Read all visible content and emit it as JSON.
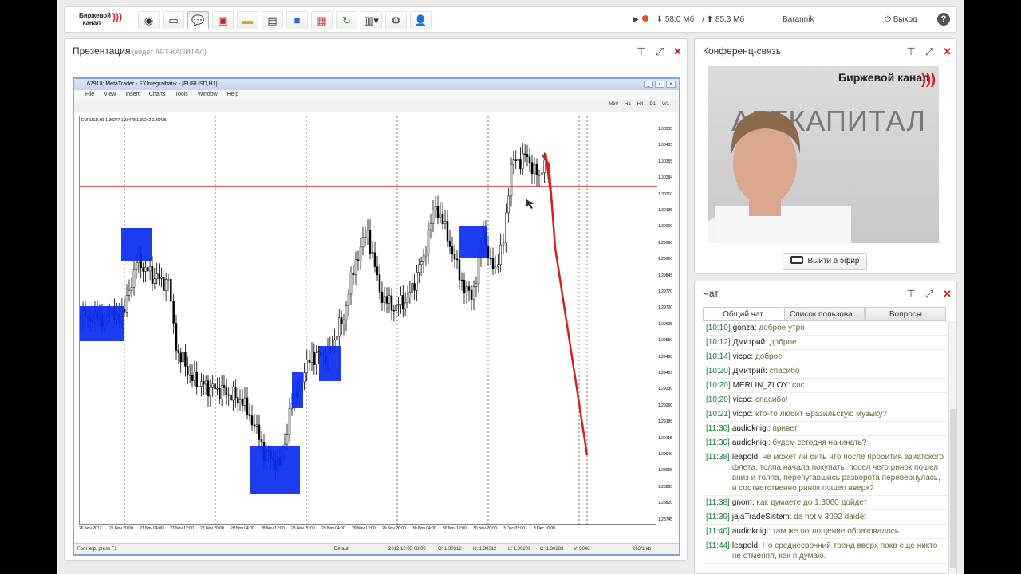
{
  "toolbar": {
    "logo_text": "Биржевой канал",
    "icons": [
      "webcam-icon",
      "screen-icon",
      "chat-bubble-icon",
      "gift-icon",
      "folder-icon",
      "document-icon",
      "boxes-icon",
      "notepad-icon",
      "share-folder-icon",
      "layout-icon",
      "gear-icon",
      "add-user-icon"
    ],
    "download": "58.0 Мб",
    "upload": "85.3 Мб",
    "username": "Barannik",
    "logout_label": "Выход",
    "help_label": "?"
  },
  "presentation": {
    "title": "Презентация",
    "subtitle": "(ведет АРТ-КАПИТАЛ)"
  },
  "metatrader": {
    "window_title": "67918: MetaTrader - FXIntegralbank - [EURUSD,H1]",
    "menu": [
      "File",
      "View",
      "Insert",
      "Charts",
      "Tools",
      "Window",
      "Help"
    ],
    "timeframes": [
      "M30",
      "H1",
      "H4",
      "D1",
      "W1"
    ],
    "symbol_line": "EURUSD,H1  1.30277 1.30478 1.30242 1.30435",
    "price_labels": [
      "1.30505",
      "1.30435",
      "1.30355",
      "1.30284",
      "1.30210",
      "1.30135",
      "1.30060",
      "1.29990",
      "1.29920",
      "1.29845",
      "1.29770",
      "1.29700",
      "1.29625",
      "1.29550",
      "1.29480",
      "1.29405",
      "1.29330",
      "1.29260",
      "1.29185",
      "1.29115",
      "1.29040",
      "1.28965",
      "1.28895",
      "1.28820",
      "1.28745"
    ],
    "time_labels": [
      "26 Nov 2012",
      "26 Nov 20:00",
      "27 Nov 04:00",
      "27 Nov 12:00",
      "27 Nov 20:00",
      "28 Nov 04:00",
      "28 Nov 12:00",
      "28 Nov 20:00",
      "29 Nov 04:00",
      "29 Nov 12:00",
      "29 Nov 20:00",
      "30 Nov 04:00",
      "30 Nov 12:00",
      "30 Nov 20:00",
      "3 Dec 02:00",
      "3 Dec 10:00"
    ],
    "status": {
      "help": "For Help, press F1",
      "profile": "Default",
      "time": "2012.12.03 08:00",
      "open": "O: 1.30312",
      "high": "H: 1.30312",
      "low": "L: 1.30209",
      "close": "C: 1.30283",
      "volume": "V: 3048",
      "traffic": "263/1 kb"
    }
  },
  "conference": {
    "title": "Конференц-связь",
    "video_logo": "Биржевой канал",
    "video_brand": "АРТКАПИТАЛ",
    "live_button": "Выйти в эфир"
  },
  "chat": {
    "title": "Чат",
    "tabs": [
      "Общий чат",
      "Список пользова...",
      "Вопросы"
    ],
    "messages": [
      {
        "time": "[10:10]",
        "nick": "gonza:",
        "text": "доброе утро"
      },
      {
        "time": "[10:12]",
        "nick": "Дмитрий:",
        "text": "доброе"
      },
      {
        "time": "[10:14]",
        "nick": "vicpc:",
        "text": "доброе"
      },
      {
        "time": "[10:20]",
        "nick": "Дмитрий:",
        "text": "спасибо"
      },
      {
        "time": "[10:20]",
        "nick": "MERLIN_ZLOY:",
        "text": "спс"
      },
      {
        "time": "[10:20]",
        "nick": "vicpc:",
        "text": "спасибо!"
      },
      {
        "time": "[10:21]",
        "nick": "vicpc:",
        "text": "кто-то любит Бразильскую музыку?"
      },
      {
        "time": "[11:30]",
        "nick": "audioknigi:",
        "text": "привет"
      },
      {
        "time": "[11:30]",
        "nick": "audioknigi:",
        "text": "будем сегодня начинать?"
      },
      {
        "time": "[11:38]",
        "nick": "leapold:",
        "text": "не может ли бить что после пробития азиатского флета, толпа начала покупать, посел чего ринок пошел вниз и толпа, перепугавшись разворота перевернулась, и соответственно ринок пошел вверх?"
      },
      {
        "time": "[11:38]",
        "nick": "gnom:",
        "text": "как думаете до 1.3060 дойдет"
      },
      {
        "time": "[11:39]",
        "nick": "jajaTradeSistem:",
        "text": "da hot v 3092 daidet"
      },
      {
        "time": "[11:40]",
        "nick": "audioknigi:",
        "text": "там же поглощение образовалось"
      },
      {
        "time": "[11:44]",
        "nick": "leapold:",
        "text": "Но среднесрочний тренд вверх пока еще никто не отменял, как я думаю."
      }
    ]
  },
  "colors": {
    "accent_red": "#d62020",
    "zone_blue": "#0a2cf0",
    "time_green": "#1a7f3a"
  }
}
